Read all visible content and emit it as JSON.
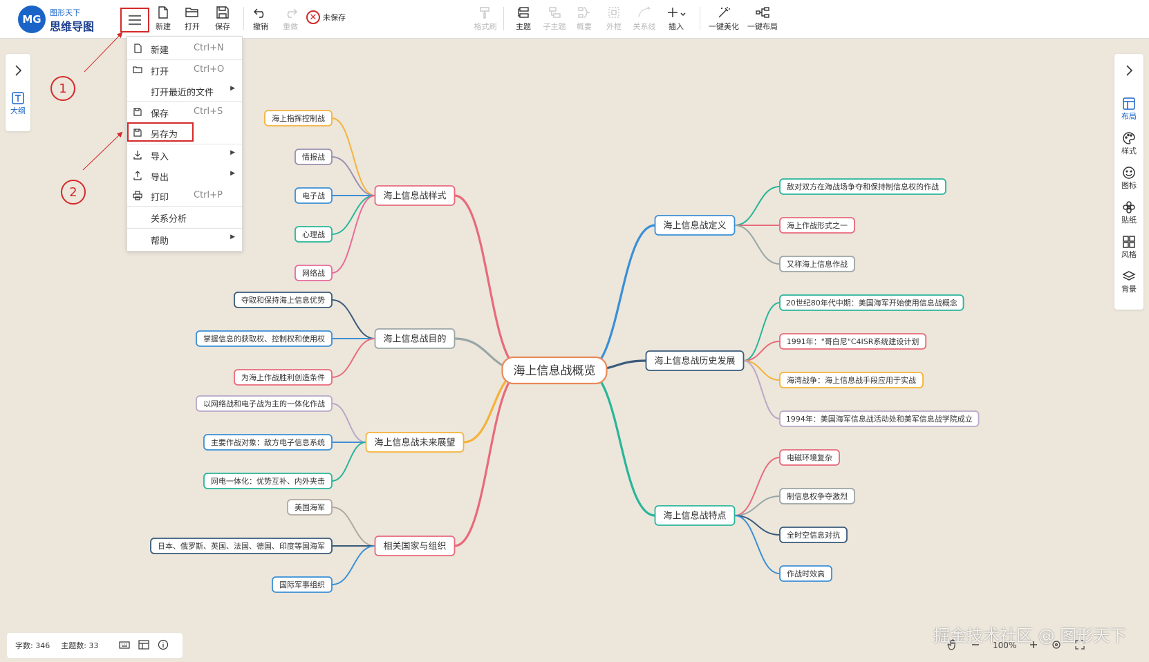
{
  "app": {
    "logo_mark": "MG",
    "logo_top": "图形天下",
    "logo_bottom": "思维导图"
  },
  "toolbar": {
    "new": "新建",
    "open": "打开",
    "save": "保存",
    "undo": "撤销",
    "redo": "重做",
    "unsaved": "未保存",
    "format_brush": "格式刷",
    "topic": "主题",
    "subtopic": "子主题",
    "summary": "概要",
    "boundary": "外框",
    "relation": "关系线",
    "insert": "插入",
    "beautify": "一键美化",
    "layout": "一键布局"
  },
  "menu": {
    "items": [
      {
        "label": "新建",
        "shortcut": "Ctrl+N"
      },
      {
        "label": "打开",
        "shortcut": "Ctrl+O"
      },
      {
        "label": "打开最近的文件",
        "shortcut": ""
      },
      {
        "label": "保存",
        "shortcut": "Ctrl+S"
      },
      {
        "label": "另存为",
        "shortcut": ""
      },
      {
        "label": "导入",
        "shortcut": ""
      },
      {
        "label": "导出",
        "shortcut": ""
      },
      {
        "label": "打印",
        "shortcut": "Ctrl+P"
      },
      {
        "label": "关系分析",
        "shortcut": ""
      },
      {
        "label": "帮助",
        "shortcut": ""
      }
    ]
  },
  "annotations": [
    "1",
    "2"
  ],
  "left_panel": {
    "outline": "大纲"
  },
  "right_panel": {
    "items": [
      "布局",
      "样式",
      "图标",
      "贴纸",
      "风格",
      "背景"
    ]
  },
  "status": {
    "word_count": "字数: 346",
    "topic_count": "主题数: 33"
  },
  "zoom": "100%",
  "watermark": "掘金技术社区 @ 图形天下",
  "mindmap": {
    "root": "海上信息战概览",
    "left": [
      {
        "title": "海上信息战样式",
        "color": "#e86a7a",
        "children": [
          {
            "t": "海上指挥控制战",
            "c": "#f5b23a"
          },
          {
            "t": "情报战",
            "c": "#9a8fb0"
          },
          {
            "t": "电子战",
            "c": "#3a8fd6"
          },
          {
            "t": "心理战",
            "c": "#28b59a"
          },
          {
            "t": "网络战",
            "c": "#e86a9a"
          }
        ]
      },
      {
        "title": "海上信息战目的",
        "color": "#9aa6a6",
        "children": [
          {
            "t": "夺取和保持海上信息优势",
            "c": "#3a5a7a"
          },
          {
            "t": "掌握信息的获取权、控制权和使用权",
            "c": "#3a8fd6"
          },
          {
            "t": "为海上作战胜利创造条件",
            "c": "#e86a7a"
          }
        ]
      },
      {
        "title": "海上信息战未来展望",
        "color": "#f5b23a",
        "children": [
          {
            "t": "以网络战和电子战为主的一体化作战",
            "c": "#b8a8c8"
          },
          {
            "t": "主要作战对象：敌方电子信息系统",
            "c": "#3a8fd6"
          },
          {
            "t": "网电一体化：优势互补、内外夹击",
            "c": "#28b59a"
          }
        ]
      },
      {
        "title": "相关国家与组织",
        "color": "#e86a7a",
        "children": [
          {
            "t": "美国海军",
            "c": "#b0a8a0"
          },
          {
            "t": "日本、俄罗斯、英国、法国、德国、印度等国海军",
            "c": "#3a5a7a"
          },
          {
            "t": "国际军事组织",
            "c": "#3a8fd6"
          }
        ]
      }
    ],
    "right": [
      {
        "title": "海上信息战定义",
        "color": "#3a8fd6",
        "children": [
          {
            "t": "敌对双方在海战场争夺和保持制信息权的作战",
            "c": "#28b59a"
          },
          {
            "t": "海上作战形式之一",
            "c": "#e86a7a"
          },
          {
            "t": "又称海上信息作战",
            "c": "#9aa6a6"
          }
        ]
      },
      {
        "title": "海上信息战历史发展",
        "color": "#3a5a7a",
        "children": [
          {
            "t": "20世纪80年代中期：美国海军开始使用信息战概念",
            "c": "#28b59a"
          },
          {
            "t": "1991年：\"哥白尼\"C4ISR系统建设计划",
            "c": "#e86a7a"
          },
          {
            "t": "海湾战争：海上信息战手段应用于实战",
            "c": "#f5b23a"
          },
          {
            "t": "1994年：美国海军信息战活动处和美军信息战学院成立",
            "c": "#b8a8c8"
          }
        ]
      },
      {
        "title": "海上信息战特点",
        "color": "#28b59a",
        "children": [
          {
            "t": "电磁环境复杂",
            "c": "#e86a7a"
          },
          {
            "t": "制信息权争夺激烈",
            "c": "#9aa6a6"
          },
          {
            "t": "全时空信息对抗",
            "c": "#3a5a7a"
          },
          {
            "t": "作战时效高",
            "c": "#3a8fd6"
          }
        ]
      }
    ]
  }
}
